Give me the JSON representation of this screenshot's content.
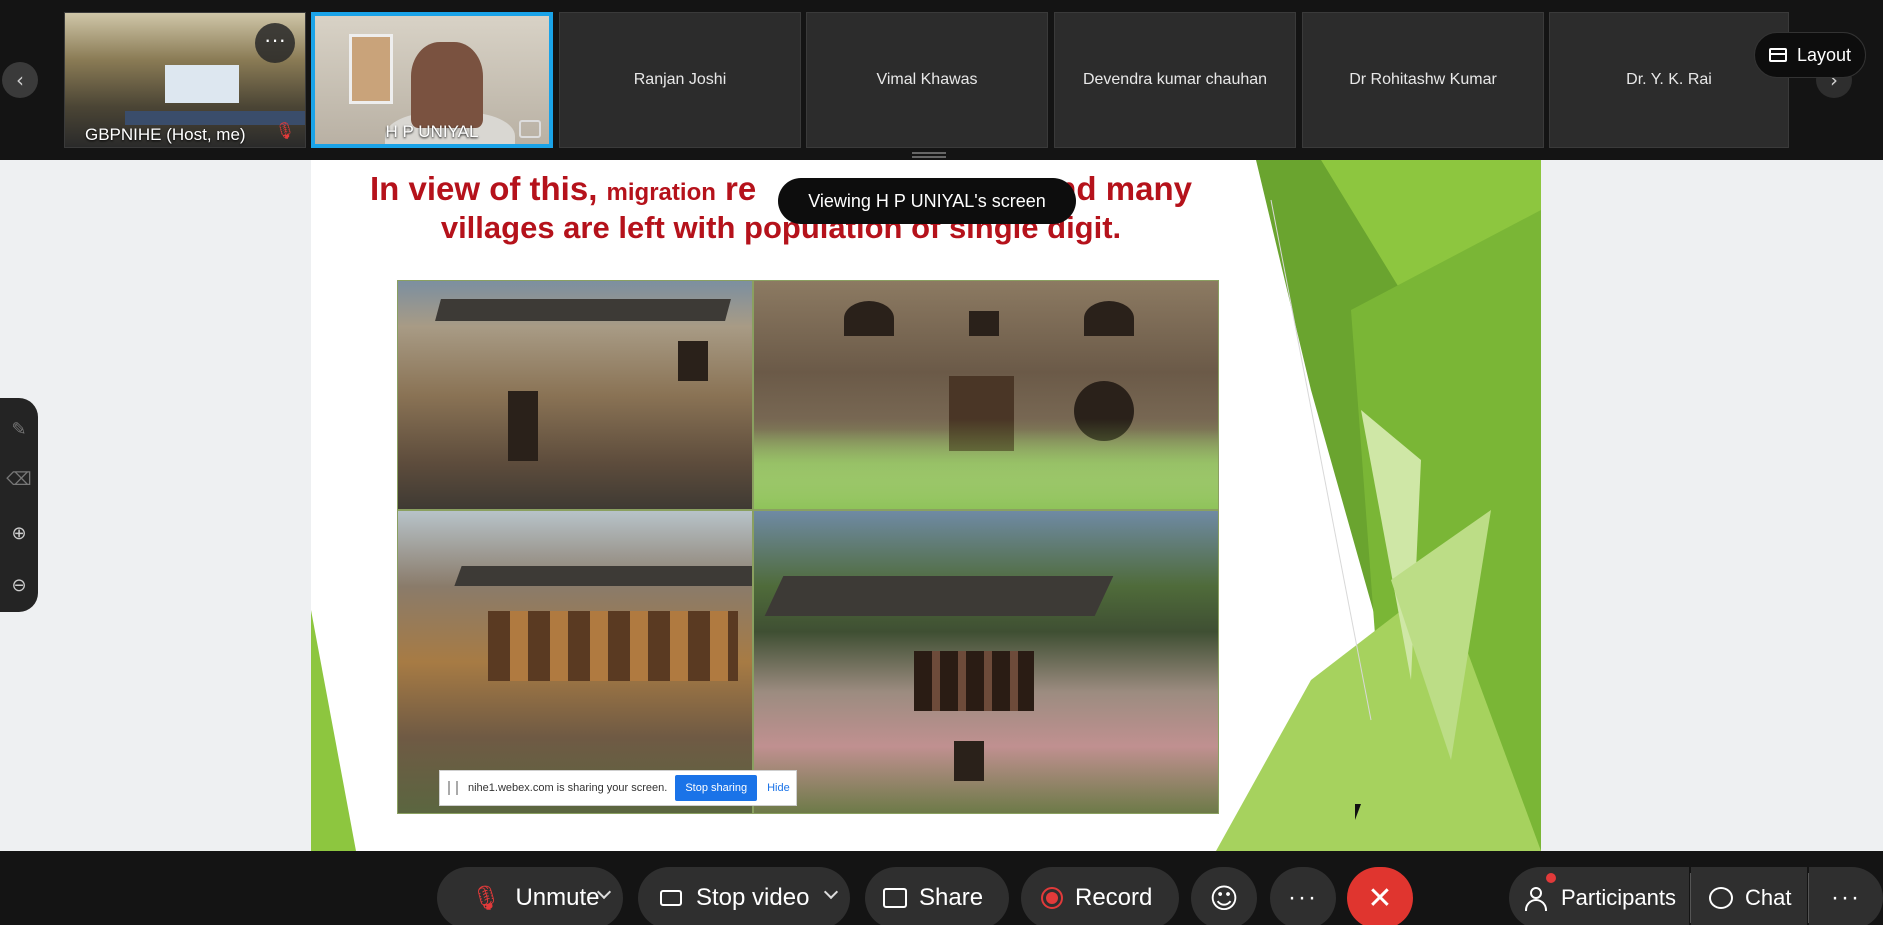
{
  "filmstrip": {
    "tiles": [
      {
        "name": "GBPNIHE  (Host, me)"
      },
      {
        "name": "H P UNIYAL"
      },
      {
        "name": "Ranjan Joshi"
      },
      {
        "name": "Vimal Khawas"
      },
      {
        "name": "Devendra kumar chauhan"
      },
      {
        "name": "Dr Rohitashw Kumar"
      },
      {
        "name": "Dr. Y. K. Rai"
      }
    ],
    "more_label": "···",
    "prev_icon": "chevron-left-icon",
    "next_icon": "chevron-right-icon"
  },
  "layout_button": {
    "label": "Layout",
    "icon": "layout-icon"
  },
  "viewing_badge": {
    "text": "Viewing H P UNIYAL's screen"
  },
  "slide": {
    "title_line1_a": "In view of this, ",
    "title_line1_b": "migration",
    "title_line1_c": " re",
    "title_line1_d": "nd many",
    "title_line2": "villages are left with population of single digit."
  },
  "share_notice": {
    "text": "nihe1.webex.com is sharing your screen.",
    "stop_label": "Stop sharing",
    "hide_label": "Hide"
  },
  "annotation_tools": [
    {
      "icon": "pen-icon"
    },
    {
      "icon": "eraser-icon"
    },
    {
      "icon": "zoom-in-icon"
    },
    {
      "icon": "zoom-out-icon"
    }
  ],
  "controls": {
    "unmute": "Unmute",
    "stop_video": "Stop video",
    "share": "Share",
    "record": "Record",
    "more": "···",
    "leave": "✕",
    "participants": "Participants",
    "chat": "Chat",
    "overflow": "···"
  },
  "colors": {
    "accent_blue": "#1aa3e8",
    "title_red": "#b5121b",
    "leave_red": "#e0352f",
    "slide_green": "#8dc63f"
  }
}
